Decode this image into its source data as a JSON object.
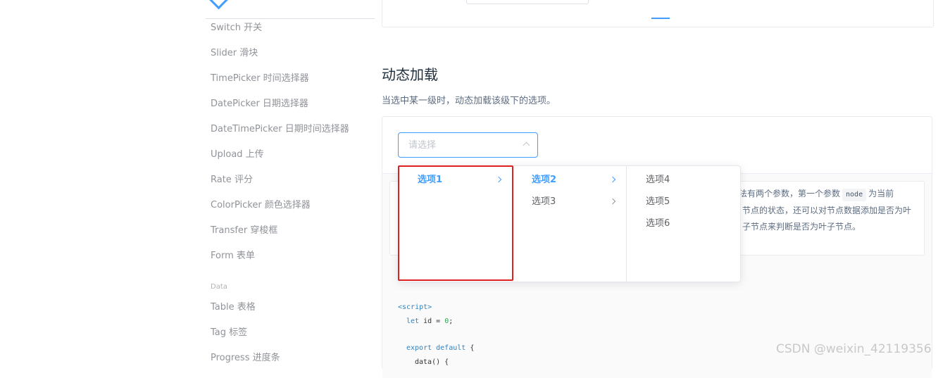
{
  "sidebar": {
    "items": [
      {
        "label": "Switch 开关"
      },
      {
        "label": "Slider 滑块"
      },
      {
        "label": "TimePicker 时间选择器"
      },
      {
        "label": "DatePicker 日期选择器"
      },
      {
        "label": "DateTimePicker 日期时间选择器"
      },
      {
        "label": "Upload 上传"
      },
      {
        "label": "Rate 评分"
      },
      {
        "label": "ColorPicker 颜色选择器"
      },
      {
        "label": "Transfer 穿梭框"
      },
      {
        "label": "Form 表单"
      }
    ],
    "group_data": "Data",
    "data_items": [
      {
        "label": "Table 表格"
      },
      {
        "label": "Tag 标签"
      },
      {
        "label": "Progress 进度条"
      }
    ]
  },
  "section": {
    "title": "动态加载",
    "description": "当选中某一级时，动态加载该级下的选项。"
  },
  "cascader": {
    "placeholder": "请选择",
    "menu1": [
      {
        "label": "选项1",
        "active": true,
        "has_children": true
      }
    ],
    "menu2": [
      {
        "label": "选项2",
        "active": true,
        "has_children": true
      },
      {
        "label": "选项3",
        "active": false,
        "has_children": true
      }
    ],
    "menu3": [
      {
        "label": "选项4"
      },
      {
        "label": "选项5"
      },
      {
        "label": "选项6"
      }
    ]
  },
  "tip": {
    "line1_pre": "方法有两个参数，第一个参数",
    "line1_code": "node",
    "line1_post": "为当前",
    "line2": "节点的状态，还可以对节点数据添加是否为叶",
    "line3": "子节点来判断是否为叶子节点。"
  },
  "code": {
    "line1": "<script>",
    "line2_kw": "let",
    "line2_txt": " id = ",
    "line2_num": "0",
    "line2_end": ";",
    "line3_kw": "export default",
    "line3_txt": " {",
    "line4": "data() {"
  },
  "watermark": "CSDN @weixin_42119356",
  "colors": {
    "accent": "#409EFF",
    "highlight": "#e02020"
  }
}
